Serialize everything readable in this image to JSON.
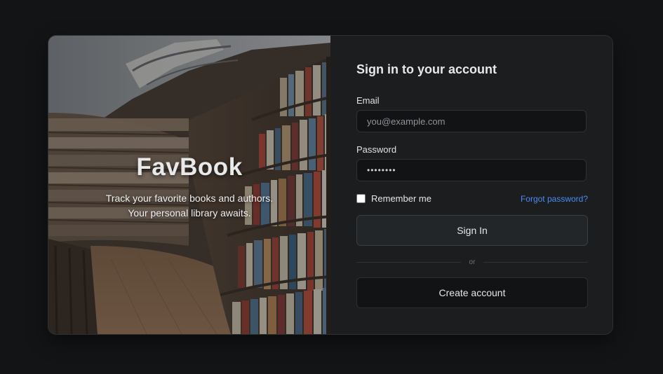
{
  "hero": {
    "title": "FavBook",
    "tagline": "Track your favorite books and authors. Your personal library awaits."
  },
  "form": {
    "title": "Sign in to your account",
    "email": {
      "label": "Email",
      "placeholder": "you@example.com"
    },
    "password": {
      "label": "Password",
      "value": "••••••••"
    },
    "remember": {
      "label": "Remember me",
      "checked": false
    },
    "forgot_label": "Forgot password?",
    "signin_label": "Sign In",
    "divider_label": "or",
    "create_label": "Create account"
  },
  "colors": {
    "page_background": "#131416",
    "panel_background": "#1b1d1f",
    "link": "#4a8cf0"
  }
}
